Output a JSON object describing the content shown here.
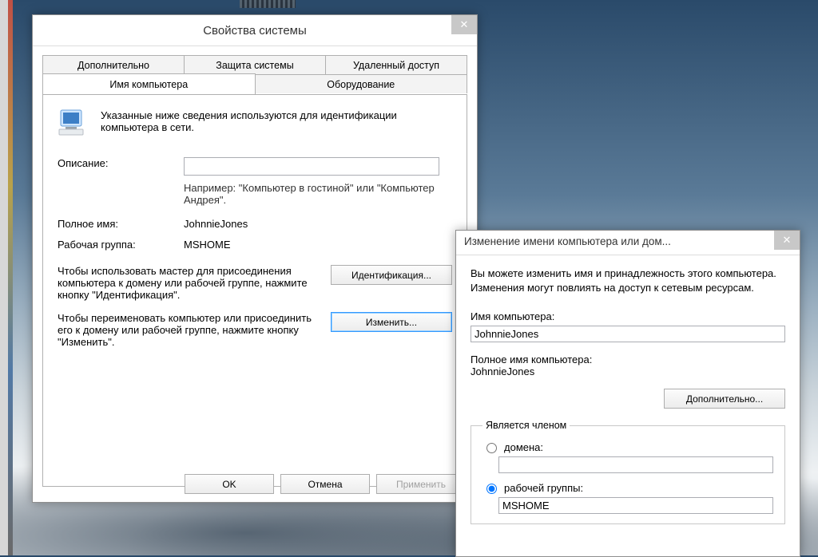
{
  "sysprops": {
    "title": "Свойства системы",
    "tabs_top": [
      "Дополнительно",
      "Защита системы",
      "Удаленный доступ"
    ],
    "tabs_bot": [
      "Имя компьютера",
      "Оборудование"
    ],
    "intro": "Указанные ниже сведения используются для идентификации компьютера в сети.",
    "description_label": "Описание:",
    "description_value": "",
    "description_hint": "Например: \"Компьютер в гостиной\" или \"Компьютер Андрея\".",
    "fullname_label": "Полное имя:",
    "fullname_value": "JohnnieJones",
    "workgroup_label": "Рабочая группа:",
    "workgroup_value": "MSHOME",
    "wizard_text": "Чтобы использовать мастер для присоединения компьютера к домену или рабочей группе, нажмите кнопку \"Идентификация\".",
    "rename_text": "Чтобы переименовать компьютер или присоединить его к домену или рабочей группе, нажмите кнопку \"Изменить\".",
    "btn_identify": "Идентификация...",
    "btn_change": "Изменить...",
    "btn_ok": "OK",
    "btn_cancel": "Отмена",
    "btn_apply": "Применить"
  },
  "change": {
    "title": "Изменение имени компьютера или дом...",
    "intro": "Вы можете изменить имя и принадлежность этого компьютера. Изменения могут повлиять на доступ к сетевым ресурсам.",
    "name_label": "Имя компьютера:",
    "name_value": "JohnnieJones",
    "fullname_label": "Полное имя компьютера:",
    "fullname_value": "JohnnieJones",
    "btn_more": "Дополнительно...",
    "member_legend": "Является членом",
    "radio_domain": "домена:",
    "domain_value": "",
    "radio_workgroup": "рабочей группы:",
    "workgroup_value": "MSHOME"
  }
}
